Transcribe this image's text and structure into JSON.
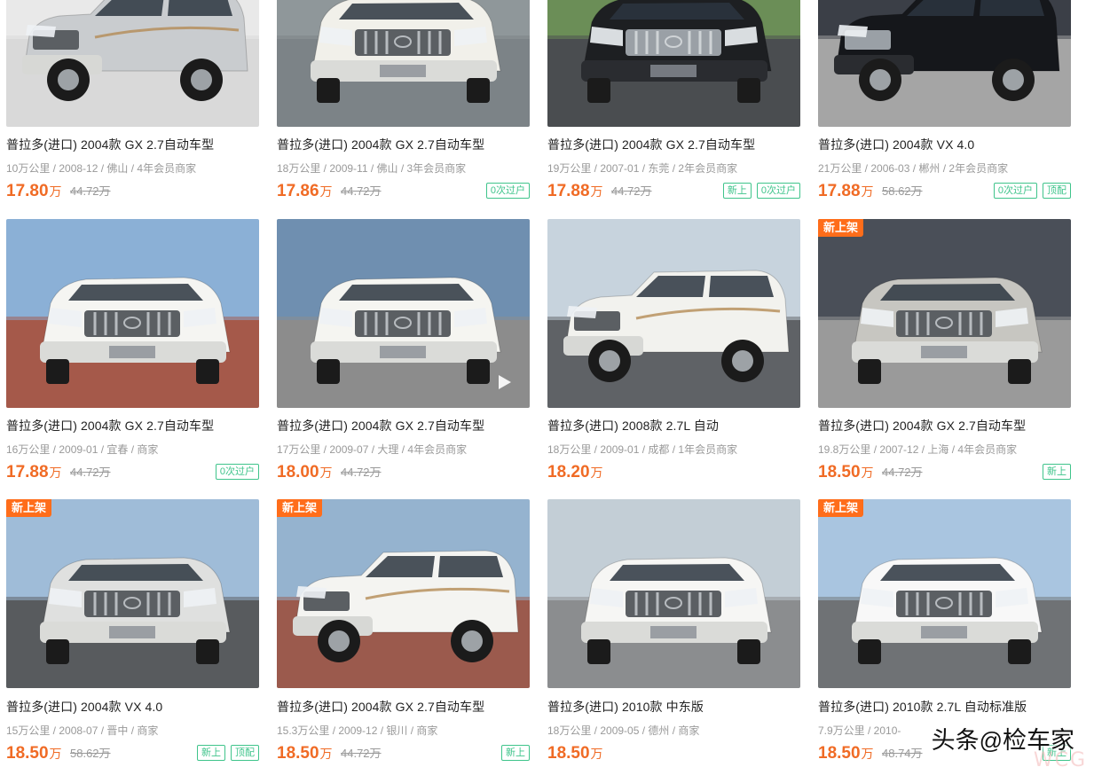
{
  "listings": [
    {
      "title": "普拉多(进口) 2004款 GX 2.7自动车型",
      "meta": "10万公里 / 2008-12 / 佛山 / 4年会员商家",
      "price": "17.80",
      "unit": "万",
      "orig": "44.72万",
      "badges": [],
      "new": false,
      "car_color": "#c9cccf",
      "bg": "#e9e9e9",
      "ground": "#d9d9d9"
    },
    {
      "title": "普拉多(进口) 2004款 GX 2.7自动车型",
      "meta": "18万公里 / 2009-11 / 佛山 / 3年会员商家",
      "price": "17.86",
      "unit": "万",
      "orig": "44.72万",
      "badges": [
        "0次过户"
      ],
      "new": false,
      "car_color": "#f1f0ea",
      "bg": "#8f979a",
      "ground": "#7c8387"
    },
    {
      "title": "普拉多(进口) 2004款 GX 2.7自动车型",
      "meta": "19万公里 / 2007-01 / 东莞 / 2年会员商家",
      "price": "17.88",
      "unit": "万",
      "orig": "44.72万",
      "badges": [
        "新上",
        "0次过户"
      ],
      "new": false,
      "car_color": "#1d1f22",
      "bg": "#6b8e57",
      "ground": "#4a4d50"
    },
    {
      "title": "普拉多(进口) 2004款 VX 4.0",
      "meta": "21万公里 / 2006-03 / 郴州 / 2年会员商家",
      "price": "17.88",
      "unit": "万",
      "orig": "58.62万",
      "badges": [
        "0次过户",
        "顶配"
      ],
      "new": false,
      "car_color": "#15171b",
      "bg": "#3b3f47",
      "ground": "#a5a5a5"
    },
    {
      "title": "普拉多(进口) 2004款 GX 2.7自动车型",
      "meta": "16万公里 / 2009-01 / 宜春 / 商家",
      "price": "17.88",
      "unit": "万",
      "orig": "44.72万",
      "badges": [
        "0次过户"
      ],
      "new": false,
      "car_color": "#f5f5f2",
      "bg": "#8bb0d6",
      "ground": "#a5594a"
    },
    {
      "title": "普拉多(进口) 2004款 GX 2.7自动车型",
      "meta": "17万公里 / 2009-07 / 大理 / 4年会员商家",
      "price": "18.00",
      "unit": "万",
      "orig": "44.72万",
      "badges": [],
      "new": false,
      "car_color": "#f5f5f1",
      "bg": "#6f8fb0",
      "ground": "#8c8c8c",
      "video": true
    },
    {
      "title": "普拉多(进口) 2008款 2.7L 自动",
      "meta": "18万公里 / 2009-01 / 成都 / 1年会员商家",
      "price": "18.20",
      "unit": "万",
      "orig": "",
      "badges": [],
      "new": false,
      "car_color": "#f2f2ee",
      "bg": "#c7d3dd",
      "ground": "#5f6266"
    },
    {
      "title": "普拉多(进口) 2004款 GX 2.7自动车型",
      "meta": "19.8万公里 / 2007-12 / 上海 / 4年会员商家",
      "price": "18.50",
      "unit": "万",
      "orig": "44.72万",
      "badges": [
        "新上"
      ],
      "new": true,
      "car_color": "#c7c6c1",
      "bg": "#4a4f58",
      "ground": "#9a9a9a"
    },
    {
      "title": "普拉多(进口) 2004款 VX 4.0",
      "meta": "15万公里 / 2008-07 / 晋中 / 商家",
      "price": "18.50",
      "unit": "万",
      "orig": "58.62万",
      "badges": [
        "新上",
        "顶配"
      ],
      "new": true,
      "car_color": "#dfe0df",
      "bg": "#9fbcd8",
      "ground": "#585b5e"
    },
    {
      "title": "普拉多(进口) 2004款 GX 2.7自动车型",
      "meta": "15.3万公里 / 2009-12 / 银川 / 商家",
      "price": "18.50",
      "unit": "万",
      "orig": "44.72万",
      "badges": [
        "新上"
      ],
      "new": true,
      "car_color": "#f4f4f1",
      "bg": "#95b3cf",
      "ground": "#9b5a4d"
    },
    {
      "title": "普拉多(进口) 2010款 中东版",
      "meta": "18万公里 / 2009-05 / 德州 / 商家",
      "price": "18.50",
      "unit": "万",
      "orig": "",
      "badges": [],
      "new": false,
      "car_color": "#f6f6f4",
      "bg": "#c3ced6",
      "ground": "#8b8d8f"
    },
    {
      "title": "普拉多(进口) 2010款 2.7L 自动标准版",
      "meta": "7.9万公里 / 2010-",
      "price": "18.50",
      "unit": "万",
      "orig": "48.74万",
      "badges": [
        "新上"
      ],
      "new": true,
      "car_color": "#f8f8f8",
      "bg": "#a9c5e0",
      "ground": "#6f7275"
    }
  ],
  "new_tag_label": "新上架",
  "watermark": {
    "prefix": "头条",
    "at": "@",
    "name": "检车家"
  },
  "faint_mark": "WCG"
}
